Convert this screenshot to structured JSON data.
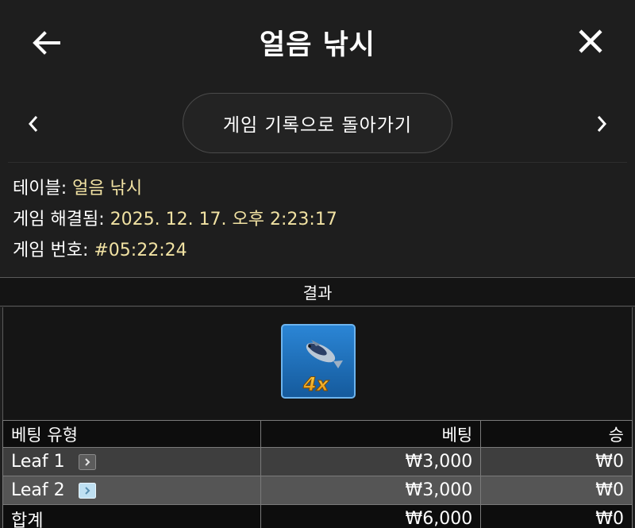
{
  "header": {
    "title": "얼음 낚시",
    "back_icon": "arrow-left-icon",
    "close_icon": "close-icon"
  },
  "navigation": {
    "prev_icon": "chevron-left-icon",
    "next_icon": "chevron-right-icon",
    "return_label": "게임 기록으로 돌아가기"
  },
  "info": {
    "table_label": "테이블:",
    "table_value": "얼음 낚시",
    "resolved_label": "게임 해결됨:",
    "resolved_value": "2025. 12. 17. 오후 2:23:17",
    "game_number_label": "게임 번호:",
    "game_number_value": "#05:22:24"
  },
  "result": {
    "header": "결과",
    "tile_icon": "fish-icon",
    "tile_multiplier": "4x"
  },
  "table": {
    "headers": [
      "베팅 유형",
      "베팅",
      "승"
    ],
    "rows": [
      {
        "type": "Leaf 1",
        "bet": "₩3,000",
        "win": "₩0",
        "icon": "leaf-marker-dark-icon"
      },
      {
        "type": "Leaf 2",
        "bet": "₩3,000",
        "win": "₩0",
        "icon": "leaf-marker-light-icon"
      }
    ],
    "total": {
      "label": "합계",
      "bet": "₩6,000",
      "win": "₩0"
    }
  },
  "colors": {
    "background": "#1e1e1e",
    "value_text": "#f1e2a3",
    "tile_blue": "#1f6fb5",
    "multiplier_gold": "#f2b31a"
  }
}
